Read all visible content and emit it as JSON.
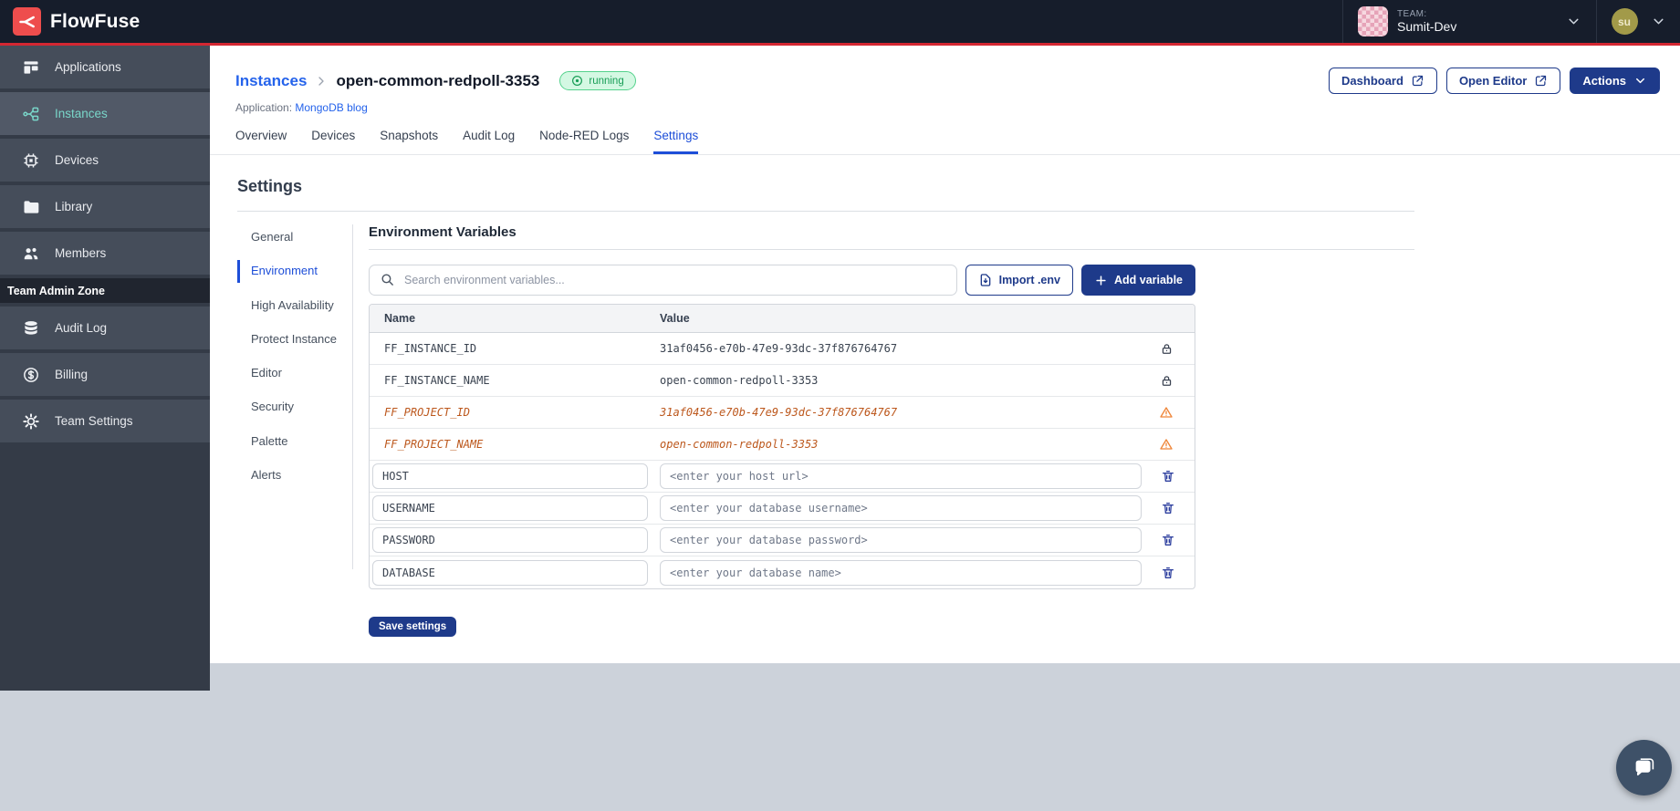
{
  "header": {
    "brand": "FlowFuse",
    "team_label": "TEAM:",
    "team_name": "Sumit-Dev",
    "user_initials": "su"
  },
  "sidebar": {
    "items": [
      {
        "label": "Applications",
        "icon": "applications-icon"
      },
      {
        "label": "Instances",
        "icon": "instances-icon",
        "active": true
      },
      {
        "label": "Devices",
        "icon": "chip-icon"
      },
      {
        "label": "Library",
        "icon": "folder-icon"
      },
      {
        "label": "Members",
        "icon": "users-icon"
      }
    ],
    "section_label": "Team Admin Zone",
    "admin_items": [
      {
        "label": "Audit Log",
        "icon": "database-icon"
      },
      {
        "label": "Billing",
        "icon": "dollar-icon"
      },
      {
        "label": "Team Settings",
        "icon": "gear-icon"
      }
    ]
  },
  "page": {
    "breadcrumb_parent": "Instances",
    "instance_name": "open-common-redpoll-3353",
    "status": "running",
    "application_label": "Application:",
    "application_name": "MongoDB blog",
    "buttons": {
      "dashboard": "Dashboard",
      "open_editor": "Open Editor",
      "actions": "Actions"
    },
    "tabs": [
      {
        "label": "Overview"
      },
      {
        "label": "Devices"
      },
      {
        "label": "Snapshots"
      },
      {
        "label": "Audit Log"
      },
      {
        "label": "Node-RED Logs"
      },
      {
        "label": "Settings",
        "active": true
      }
    ]
  },
  "settings": {
    "title": "Settings",
    "nav": [
      "General",
      "Environment",
      "High Availability",
      "Protect Instance",
      "Editor",
      "Security",
      "Palette",
      "Alerts"
    ],
    "active_nav": "Environment"
  },
  "env": {
    "title": "Environment Variables",
    "search_placeholder": "Search environment variables...",
    "import_label": "Import .env",
    "add_label": "Add variable",
    "save_label": "Save settings",
    "table": {
      "columns": {
        "name": "Name",
        "value": "Value"
      },
      "locked_rows": [
        {
          "name": "FF_INSTANCE_ID",
          "value": "31af0456-e70b-47e9-93dc-37f876764767",
          "icon": "lock"
        },
        {
          "name": "FF_INSTANCE_NAME",
          "value": "open-common-redpoll-3353",
          "icon": "lock"
        },
        {
          "name": "FF_PROJECT_ID",
          "value": "31af0456-e70b-47e9-93dc-37f876764767",
          "icon": "warning",
          "deprecated": true
        },
        {
          "name": "FF_PROJECT_NAME",
          "value": "open-common-redpoll-3353",
          "icon": "warning",
          "deprecated": true
        }
      ],
      "editable_rows": [
        {
          "name": "HOST",
          "placeholder": "<enter your host url>",
          "icon": "trash"
        },
        {
          "name": "USERNAME",
          "placeholder": "<enter your database username>",
          "icon": "trash"
        },
        {
          "name": "PASSWORD",
          "placeholder": "<enter your database password>",
          "icon": "trash"
        },
        {
          "name": "DATABASE",
          "placeholder": "<enter your database name>",
          "icon": "trash"
        }
      ]
    }
  },
  "colors": {
    "accent_navy": "#1e3a8a",
    "link_blue": "#2563eb",
    "active_blue": "#1d4ed8",
    "brand_red": "#ee4d4d",
    "header_red_line": "#d42732",
    "sidebar_active_teal": "#79d6c9",
    "status_green": "#199e57",
    "deprecated_orange": "#bc571c",
    "warning_orange": "#ef8538"
  }
}
